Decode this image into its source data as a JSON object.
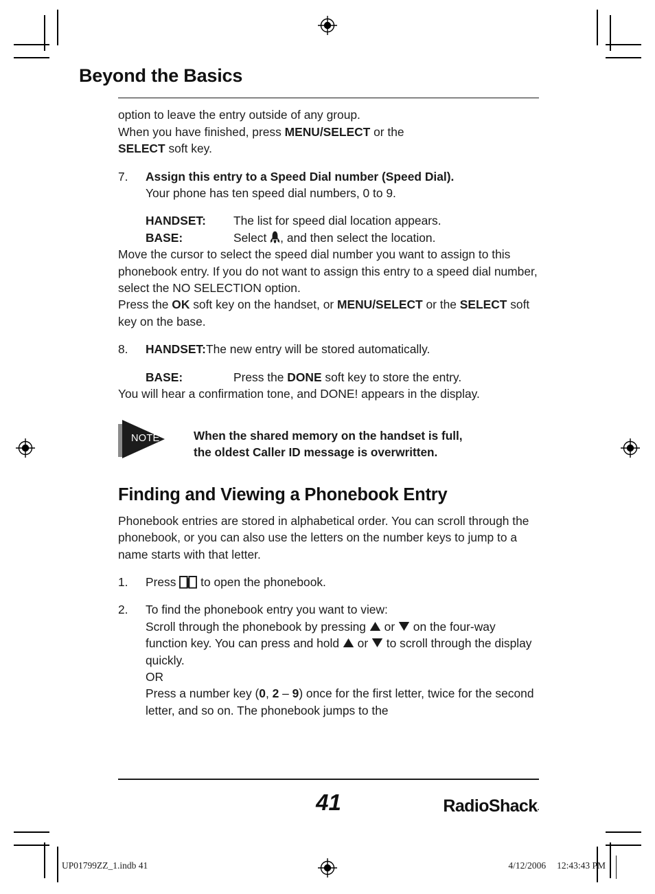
{
  "chapter": {
    "title": "Beyond the Basics"
  },
  "intro": {
    "line1": "option to leave the entry outside of any group.",
    "line2_a": "When you have finished, press ",
    "line2_b": "MENU/SELECT",
    "line2_c": " or the ",
    "line3_b": "SELECT",
    "line3_c": " soft key."
  },
  "step7": {
    "number": "7.",
    "heading": "Assign this entry to a Speed Dial number (Speed Dial).",
    "subtext": "Your phone has ten speed dial numbers, 0 to 9.",
    "handset_label": "HANDSET:",
    "handset_text": "The list for speed dial location appears.",
    "base_label": "BASE:",
    "base_text_a": "Select ",
    "base_text_b": ", and then select the location.",
    "body": "Move the cursor to select the speed dial number you want to assign to this phonebook entry. If you do not want to assign this entry to a speed dial number, select the NO SELECTION option.",
    "press_a": "Press the ",
    "press_b": "OK",
    "press_c": " soft key on the handset, or ",
    "press_d": "MENU/SELECT",
    "press_e": " or the ",
    "press_f": "SELECT",
    "press_g": " soft key on the base."
  },
  "step8": {
    "number": "8.",
    "handset_label": "HANDSET:",
    "handset_text": "The new entry will be stored automatically.",
    "base_label": "BASE:",
    "base_text_a": "Press the ",
    "base_text_b": "DONE",
    "base_text_c": " soft key to store the entry.",
    "body": "You will hear a confirmation tone, and DONE! appears in the display."
  },
  "note": {
    "label": "NOTE",
    "line1": "When the shared memory on the handset is full,",
    "line2": "the oldest Caller ID message is overwritten."
  },
  "section": {
    "title": "Finding and Viewing a Phonebook Entry",
    "intro": "Phonebook entries are stored in alphabetical order. You can scroll through the phonebook, or you can also use the letters on the number keys to jump to a name starts with that letter."
  },
  "step_find_1": {
    "number": "1.",
    "text_a": "Press ",
    "text_b": " to open the phonebook."
  },
  "step_find_2": {
    "number": "2.",
    "line1": "To find the phonebook entry you want to view:",
    "line2_a": "Scroll through the phonebook by pressing ",
    "line2_b": " or ",
    "line2_c": " on the four-way function key. You can press and hold ",
    "line2_d": " or ",
    "line2_e": " to scroll through the display quickly.",
    "or": "OR",
    "line3_a": "Press a number key (",
    "line3_b": "0",
    "line3_c": ", ",
    "line3_d": "2",
    "line3_e": " – ",
    "line3_f": "9",
    "line3_g": ") once for the first letter, twice for the second letter, and so on. The phonebook jumps to the"
  },
  "footer": {
    "page_number": "41",
    "brand": "RadioShack",
    "brand_reg": "."
  },
  "print_info": {
    "file": "UP01799ZZ_1.indb   41",
    "date": "4/12/2006",
    "time": "12:43:43 PM"
  },
  "icons": {
    "rocket": "rocket-icon",
    "book": "open-book-icon",
    "triangle_up": "triangle-up-icon",
    "triangle_down": "triangle-down-icon",
    "registration": "registration-target-icon"
  },
  "colors": {
    "ink": "#1a1a1a",
    "note_badge": "#1c1c1c",
    "note_shadow": "#8c8c8c",
    "paper": "#ffffff"
  }
}
